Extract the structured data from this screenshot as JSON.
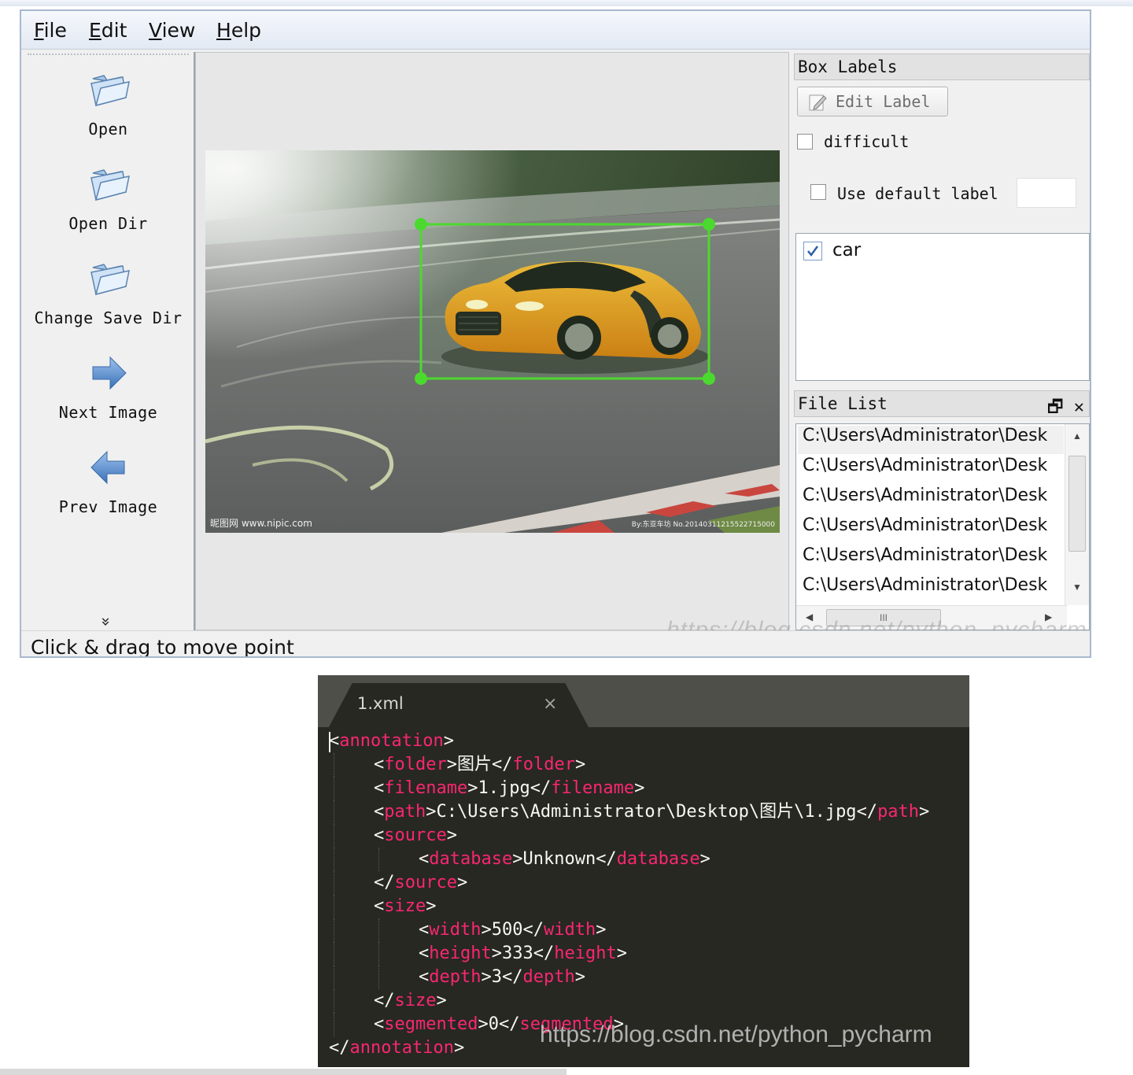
{
  "menu": [
    {
      "key": "F",
      "rest": "ile"
    },
    {
      "key": "E",
      "rest": "dit"
    },
    {
      "key": "V",
      "rest": "iew"
    },
    {
      "key": "H",
      "rest": "elp"
    }
  ],
  "toolbar": {
    "open": {
      "label": "Open",
      "icon": "folder-icon"
    },
    "open_dir": {
      "label": "Open Dir",
      "icon": "folder-icon"
    },
    "change_save_dir": {
      "label": "Change Save Dir",
      "icon": "folder-icon"
    },
    "next_image": {
      "label": "Next Image",
      "icon": "arrow-right-icon"
    },
    "prev_image": {
      "label": "Prev Image",
      "icon": "arrow-left-icon"
    },
    "more": "»"
  },
  "box_labels": {
    "title": "Box Labels",
    "edit_label_button": "Edit Label",
    "difficult": {
      "label": "difficult",
      "checked": false
    },
    "use_default_label": {
      "label": "Use default label",
      "checked": false,
      "value": ""
    },
    "labels": [
      {
        "text": "car",
        "checked": true
      }
    ]
  },
  "file_list": {
    "title": "File List",
    "float_button": "🗗",
    "close_button": "✕",
    "items": [
      "C:\\Users\\Administrator\\Desk",
      "C:\\Users\\Administrator\\Desk",
      "C:\\Users\\Administrator\\Desk",
      "C:\\Users\\Administrator\\Desk",
      "C:\\Users\\Administrator\\Desk",
      "C:\\Users\\Administrator\\Desk"
    ],
    "hscroll_grip": "III"
  },
  "status": "Click & drag to move point",
  "photo_captions": {
    "left": "昵图网 www.nipic.com",
    "right": "By:东亚车坊 No.20140311215522715000"
  },
  "watermark_top": "https://blog.csdn.net/python_pycharm",
  "editor": {
    "tab_name": "1.xml",
    "tab_close": "×",
    "lines": [
      {
        "indent": 0,
        "open": "annotation",
        "text": "",
        "close": ""
      },
      {
        "indent": 1,
        "open": "folder",
        "text": "图片",
        "close": "folder"
      },
      {
        "indent": 1,
        "open": "filename",
        "text": "1.jpg",
        "close": "filename"
      },
      {
        "indent": 1,
        "open": "path",
        "text": "C:\\Users\\Administrator\\Desktop\\图片\\1.jpg",
        "close": "path"
      },
      {
        "indent": 1,
        "open": "source",
        "text": "",
        "close": ""
      },
      {
        "indent": 2,
        "open": "database",
        "text": "Unknown",
        "close": "database"
      },
      {
        "indent": 1,
        "open": "",
        "text": "",
        "close": "source"
      },
      {
        "indent": 1,
        "open": "size",
        "text": "",
        "close": ""
      },
      {
        "indent": 2,
        "open": "width",
        "text": "500",
        "close": "width"
      },
      {
        "indent": 2,
        "open": "height",
        "text": "333",
        "close": "height"
      },
      {
        "indent": 2,
        "open": "depth",
        "text": "3",
        "close": "depth"
      },
      {
        "indent": 1,
        "open": "",
        "text": "",
        "close": "size"
      },
      {
        "indent": 1,
        "open": "segmented",
        "text": "0",
        "close": "segmented"
      },
      {
        "indent": 0,
        "open": "",
        "text": "",
        "close": "annotation"
      }
    ],
    "watermark": "https://blog.csdn.net/python_pycharm"
  },
  "colors": {
    "bbox": "#4cd92f",
    "tag": "#f92672",
    "editor_bg": "#272822"
  }
}
